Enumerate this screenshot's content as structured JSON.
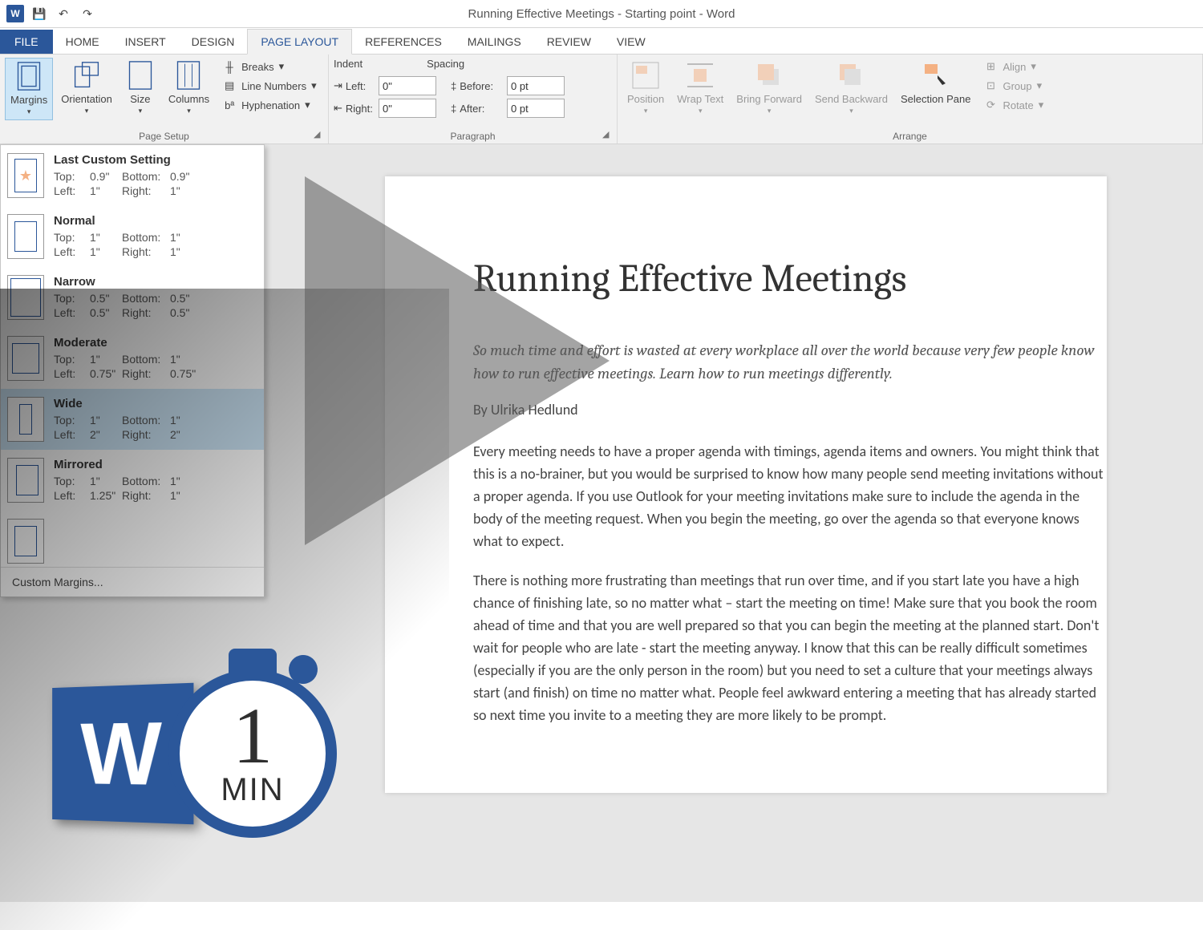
{
  "window_title": "Running Effective Meetings - Starting point - Word",
  "tabs": {
    "file": "FILE",
    "home": "HOME",
    "insert": "INSERT",
    "design": "DESIGN",
    "page_layout": "PAGE LAYOUT",
    "references": "REFERENCES",
    "mailings": "MAILINGS",
    "review": "REVIEW",
    "view": "VIEW"
  },
  "page_setup": {
    "margins": "Margins",
    "orientation": "Orientation",
    "size": "Size",
    "columns": "Columns",
    "breaks": "Breaks",
    "line_numbers": "Line Numbers",
    "hyphenation": "Hyphenation",
    "group": "Page Setup"
  },
  "paragraph": {
    "indent_header": "Indent",
    "spacing_header": "Spacing",
    "left_label": "Left:",
    "right_label": "Right:",
    "before_label": "Before:",
    "after_label": "After:",
    "left_val": "0\"",
    "right_val": "0\"",
    "before_val": "0 pt",
    "after_val": "0 pt",
    "group": "Paragraph"
  },
  "arrange": {
    "position": "Position",
    "wrap": "Wrap Text",
    "forward": "Bring Forward",
    "backward": "Send Backward",
    "selection": "Selection Pane",
    "align": "Align",
    "group_btn": "Group",
    "rotate": "Rotate",
    "group": "Arrange"
  },
  "margins_menu": {
    "last": {
      "name": "Last Custom Setting",
      "top": "0.9\"",
      "bottom": "0.9\"",
      "left": "1\"",
      "right": "1\""
    },
    "normal": {
      "name": "Normal",
      "top": "1\"",
      "bottom": "1\"",
      "left": "1\"",
      "right": "1\""
    },
    "narrow": {
      "name": "Narrow",
      "top": "0.5\"",
      "bottom": "0.5\"",
      "left": "0.5\"",
      "right": "0.5\""
    },
    "moderate": {
      "name": "Moderate",
      "top": "1\"",
      "bottom": "1\"",
      "left": "0.75\"",
      "right": "0.75\""
    },
    "wide": {
      "name": "Wide",
      "top": "1\"",
      "bottom": "1\"",
      "left": "2\"",
      "right": "2\""
    },
    "mirrored": {
      "name": "Mirrored",
      "top": "1\"",
      "bottom": "1\"",
      "left": "1.25\"",
      "right": "1\""
    },
    "labels": {
      "top": "Top:",
      "bottom": "Bottom:",
      "left": "Left:",
      "right": "Right:"
    },
    "custom": "Custom Margins..."
  },
  "document": {
    "title": "Running Effective Meetings",
    "subtitle": "So much time and effort is wasted at every workplace all over the world because very few people know how to run effective meetings. Learn how to run meetings differently.",
    "byline": "By Ulrika Hedlund",
    "p1": "Every meeting needs to have a proper agenda with timings, agenda items and owners. You might think that this is a no-brainer, but you would be surprised to know how many people send meeting invitations without a proper agenda. If you use Outlook for your meeting invitations make sure to include the agenda in the body of the meeting request. When you begin the meeting, go over the agenda so that everyone knows what to expect.",
    "p2": "There is nothing more frustrating than meetings that run over time, and if you start late you have a high chance of finishing late, so no matter what – start the meeting on time! Make sure that you book the room ahead of time and that you are well prepared so that you can begin the meeting at the planned start. Don't wait for people who are late - start the meeting anyway. I know that this can be really difficult sometimes (especially if you are the only person in the room) but you need to set a culture that your meetings always start (and finish) on time no matter what. People feel awkward entering a meeting that has already started so next time you invite to a meeting they are more likely to be prompt."
  },
  "badge": {
    "num": "1",
    "min": "MIN"
  }
}
